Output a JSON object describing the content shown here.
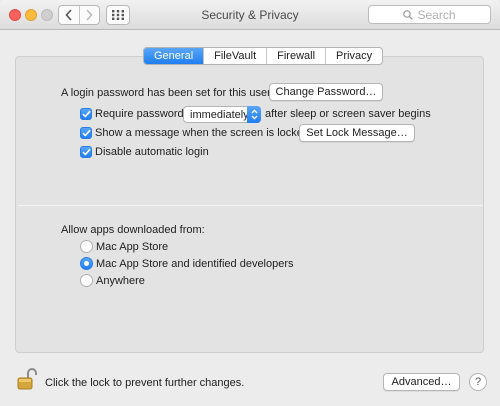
{
  "window": {
    "title": "Security & Privacy"
  },
  "toolbar": {
    "search_placeholder": "Search"
  },
  "tabs": [
    {
      "label": "General",
      "active": true
    },
    {
      "label": "FileVault",
      "active": false
    },
    {
      "label": "Firewall",
      "active": false
    },
    {
      "label": "Privacy",
      "active": false
    }
  ],
  "general": {
    "login_password_text": "A login password has been set for this user",
    "change_password_label": "Change Password…",
    "require_password": {
      "label": "Require password",
      "checked": true,
      "selected": "immediately",
      "suffix": "after sleep or screen saver begins"
    },
    "show_message": {
      "label": "Show a message when the screen is locked",
      "checked": true,
      "button": "Set Lock Message…"
    },
    "disable_auto_login": {
      "label": "Disable automatic login",
      "checked": true
    }
  },
  "downloads": {
    "heading": "Allow apps downloaded from:",
    "options": [
      {
        "label": "Mac App Store",
        "selected": false
      },
      {
        "label": "Mac App Store and identified developers",
        "selected": true
      },
      {
        "label": "Anywhere",
        "selected": false
      }
    ]
  },
  "footer": {
    "lock_text": "Click the lock to prevent further changes.",
    "advanced_label": "Advanced…",
    "help_label": "?"
  },
  "colors": {
    "accent": "#1f7ef1",
    "close": "#fc605b",
    "minimize": "#fdbc40",
    "lock": "#c9a23a"
  }
}
